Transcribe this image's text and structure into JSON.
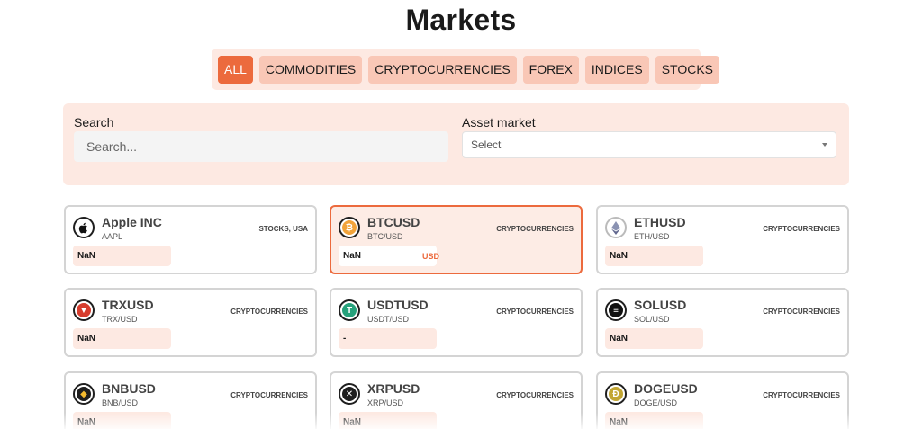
{
  "page": {
    "title": "Markets"
  },
  "tabs": [
    "ALL",
    "COMMODITIES",
    "CRYPTOCURRENCIES",
    "FOREX",
    "INDICES",
    "STOCKS"
  ],
  "filters": {
    "search_label": "Search",
    "search_placeholder": "Search...",
    "asset_label": "Asset market",
    "asset_value": "Select"
  },
  "colors": {
    "accent": "#ec6a3d",
    "panel": "#fde9e2",
    "tab": "#f9c7b6"
  },
  "cards": [
    {
      "name": "Apple INC",
      "pair": "AAPL",
      "category": "STOCKS, USA",
      "price": "NaN",
      "currency": "",
      "icon": "apple-icon",
      "selected": false
    },
    {
      "name": "BTCUSD",
      "pair": "BTC/USD",
      "category": "CRYPTOCURRENCIES",
      "price": "NaN",
      "currency": "USD",
      "icon": "bitcoin-icon",
      "selected": true
    },
    {
      "name": "ETHUSD",
      "pair": "ETH/USD",
      "category": "CRYPTOCURRENCIES",
      "price": "NaN",
      "currency": "",
      "icon": "ethereum-icon",
      "selected": false
    },
    {
      "name": "TRXUSD",
      "pair": "TRX/USD",
      "category": "CRYPTOCURRENCIES",
      "price": "NaN",
      "currency": "",
      "icon": "tron-icon",
      "selected": false
    },
    {
      "name": "USDTUSD",
      "pair": "USDT/USD",
      "category": "CRYPTOCURRENCIES",
      "price": "-",
      "currency": "",
      "icon": "tether-icon",
      "selected": false
    },
    {
      "name": "SOLUSD",
      "pair": "SOL/USD",
      "category": "CRYPTOCURRENCIES",
      "price": "NaN",
      "currency": "",
      "icon": "solana-icon",
      "selected": false
    },
    {
      "name": "BNBUSD",
      "pair": "BNB/USD",
      "category": "CRYPTOCURRENCIES",
      "price": "NaN",
      "currency": "",
      "icon": "bnb-icon",
      "selected": false
    },
    {
      "name": "XRPUSD",
      "pair": "XRP/USD",
      "category": "CRYPTOCURRENCIES",
      "price": "NaN",
      "currency": "",
      "icon": "xrp-icon",
      "selected": false
    },
    {
      "name": "DOGEUSD",
      "pair": "DOGE/USD",
      "category": "CRYPTOCURRENCIES",
      "price": "NaN",
      "currency": "",
      "icon": "dogecoin-icon",
      "selected": false
    }
  ]
}
